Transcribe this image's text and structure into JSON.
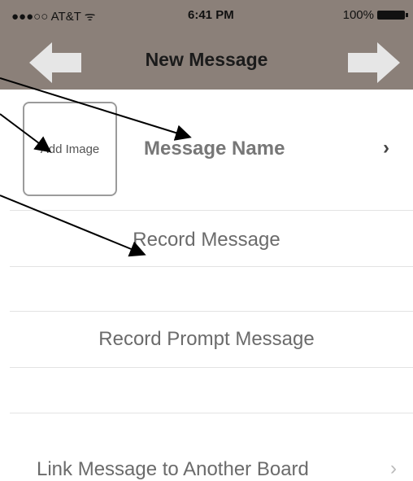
{
  "status_bar": {
    "carrier": "●●●○○ AT&T ᯤ",
    "time": "6:41 PM",
    "battery": "100%"
  },
  "nav": {
    "title": "New Message",
    "back_icon": "left-arrow-icon",
    "forward_icon": "right-arrow-icon"
  },
  "rows": {
    "add_image": "Add Image",
    "message_name": "Message Name",
    "record_message": "Record Message",
    "record_prompt": "Record Prompt Message",
    "link_board": "Link Message to Another Board"
  },
  "colors": {
    "bar": "#8b8079",
    "arrow_fill": "#e6e6e6"
  }
}
